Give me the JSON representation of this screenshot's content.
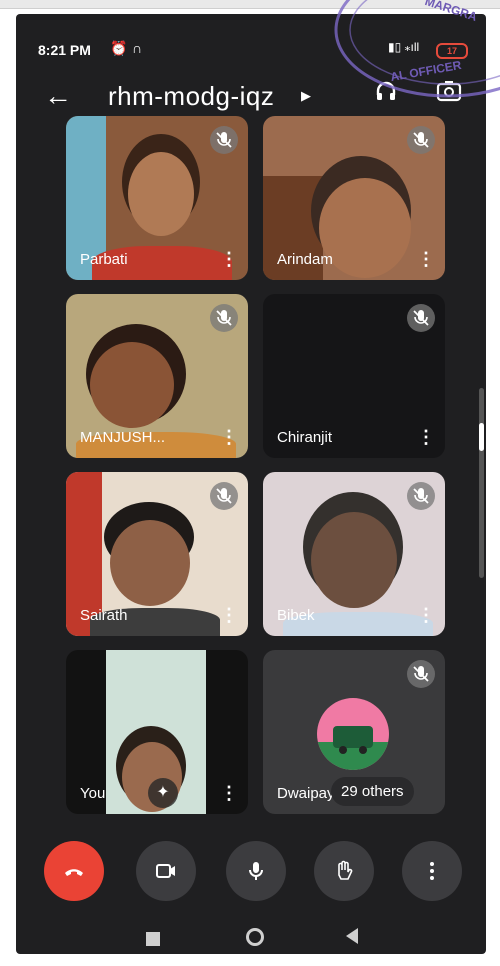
{
  "status_bar": {
    "time": "8:21 PM",
    "alarm_icon": "alarm-icon",
    "headphone_icon": "headset-icon",
    "battery": "17"
  },
  "header": {
    "meeting_code": "rhm-modg-iqz",
    "back_icon": "back-arrow-icon",
    "audio_icon": "headphones-icon",
    "switch_camera_icon": "switch-camera-icon"
  },
  "stamp": {
    "text_top": "MARGRA",
    "text_bottom": "AL OFFICER"
  },
  "participants": [
    {
      "name": "Parbati",
      "muted": true
    },
    {
      "name": "Arindam",
      "muted": true
    },
    {
      "name": "MANJUSH...",
      "muted": true
    },
    {
      "name": "Chiranjit",
      "muted": true
    },
    {
      "name": "Sairath",
      "muted": true
    },
    {
      "name": "Bibek",
      "muted": true
    },
    {
      "name": "You",
      "muted": false
    },
    {
      "name": "Dwaipayan",
      "muted": true
    }
  ],
  "others_label": "29 others",
  "controls": {
    "end_call": "end-call-icon",
    "camera": "video-camera-icon",
    "mic": "mic-icon",
    "raise_hand": "raise-hand-icon",
    "more": "more-vertical-icon"
  },
  "colors": {
    "end_call": "#ea4335",
    "tile_bg": "#2e2e30",
    "screen_bg": "#1f1f21"
  }
}
